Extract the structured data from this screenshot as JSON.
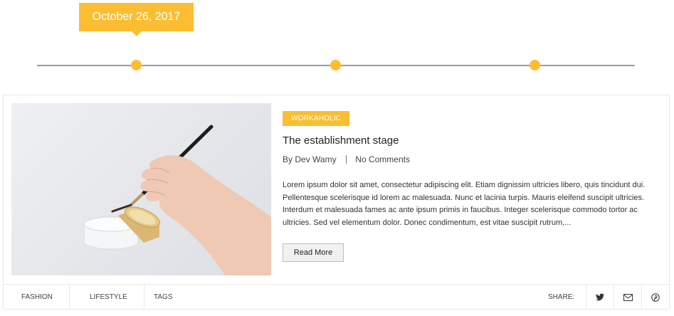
{
  "timeline": {
    "tooltip_date": "October 26, 2017",
    "accent_color": "#fbbe32",
    "dot_count": 3
  },
  "post": {
    "category": "WORKAHOLIC",
    "title": "The establishment stage",
    "by_label": "By",
    "author": "Dev Wamy",
    "comments": "No Comments",
    "excerpt": "Lorem ipsum dolor sit amet, consectetur adipiscing elit. Etiam dignissim ultricies libero, quis tincidunt dui. Pellentesque scelerisque id lorem ac malesuada. Nunc et lacinia turpis. Mauris eleifend suscipit ultricies. Interdum et malesuada fames ac ante ipsum primis in faucibus. Integer scelerisque commodo tortor ac ultricies. Sed vel elementum dolor. Donec condimentum, est vitae suscipit rutrum,...",
    "read_more_label": "Read More"
  },
  "footer": {
    "tags": [
      "FASHION",
      "LIFESTYLE",
      "TAGS"
    ],
    "share_label": "SHARE:",
    "share_icons": [
      "twitter-icon",
      "email-icon",
      "pinterest-icon"
    ]
  }
}
